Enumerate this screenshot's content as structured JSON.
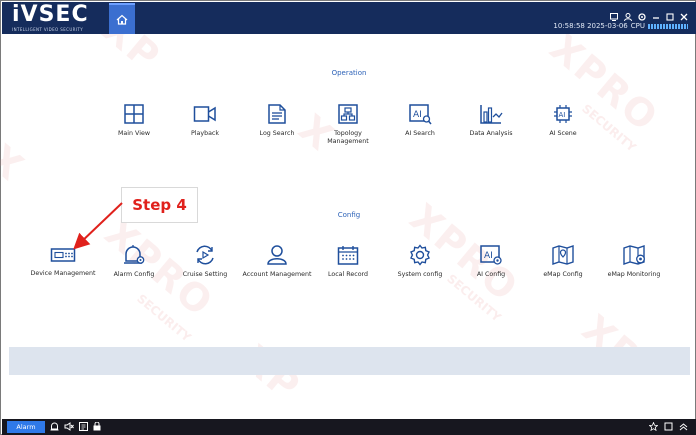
{
  "app": {
    "logo": "iVSEC",
    "logo_subtitle": "INTELLIGENT VIDEO SECURITY",
    "clock": "10:58:58 2025-03-06",
    "cpu_label": "CPU"
  },
  "sections": {
    "operation_title": "Operation",
    "config_title": "Config"
  },
  "operation_items": [
    {
      "label": "Main View",
      "icon": "main-view-icon"
    },
    {
      "label": "Playback",
      "icon": "playback-icon"
    },
    {
      "label": "Log Search",
      "icon": "log-search-icon"
    },
    {
      "label": "Topology Management",
      "icon": "topology-icon"
    },
    {
      "label": "AI Search",
      "icon": "ai-search-icon"
    },
    {
      "label": "Data Analysis",
      "icon": "data-analysis-icon"
    },
    {
      "label": "AI Scene",
      "icon": "ai-scene-icon"
    }
  ],
  "config_items": [
    {
      "label": "Device Management",
      "icon": "device-management-icon"
    },
    {
      "label": "Alarm Config",
      "icon": "alarm-config-icon"
    },
    {
      "label": "Cruise Setting",
      "icon": "cruise-setting-icon"
    },
    {
      "label": "Account Management",
      "icon": "account-management-icon"
    },
    {
      "label": "Local Record",
      "icon": "local-record-icon"
    },
    {
      "label": "System config",
      "icon": "system-config-icon"
    },
    {
      "label": "AI Config",
      "icon": "ai-config-icon"
    },
    {
      "label": "eMap Config",
      "icon": "emap-config-icon"
    },
    {
      "label": "eMap Monitoring",
      "icon": "emap-monitoring-icon"
    }
  ],
  "annotation": {
    "step_label": "Step 4",
    "color": "#e0211c"
  },
  "bottombar": {
    "alarm_label": "Alarm"
  },
  "watermark": {
    "text": "XPRO",
    "subtext": "SECURITY"
  },
  "colors": {
    "topbar": "#152c5c",
    "accent": "#2e63b8",
    "icon": "#1f4f9c",
    "panel": "#dde4ee"
  }
}
